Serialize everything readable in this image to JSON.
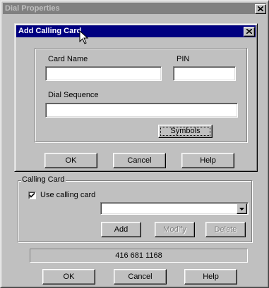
{
  "main_window": {
    "title": "Dial Properties",
    "calling_card_group": {
      "legend": "Calling Card",
      "use_calling_card_label": "Use calling card",
      "use_calling_card_checked": true,
      "card_select_value": "",
      "add_label": "Add",
      "modify_label": "Modify",
      "delete_label": "Delete"
    },
    "phone_display": "416 681 1168",
    "ok_label": "OK",
    "cancel_label": "Cancel",
    "help_label": "Help"
  },
  "dialog": {
    "title": "Add Calling Card",
    "card_name_label": "Card Name",
    "card_name_value": "",
    "pin_label": "PIN",
    "pin_value": "",
    "dial_sequence_label": "Dial Sequence",
    "dial_sequence_value": "",
    "symbols_label": "Symbols",
    "ok_label": "OK",
    "cancel_label": "Cancel",
    "help_label": "Help"
  },
  "colors": {
    "active_title": "#000080",
    "inactive_title": "#808080",
    "face": "#c0c0c0"
  }
}
